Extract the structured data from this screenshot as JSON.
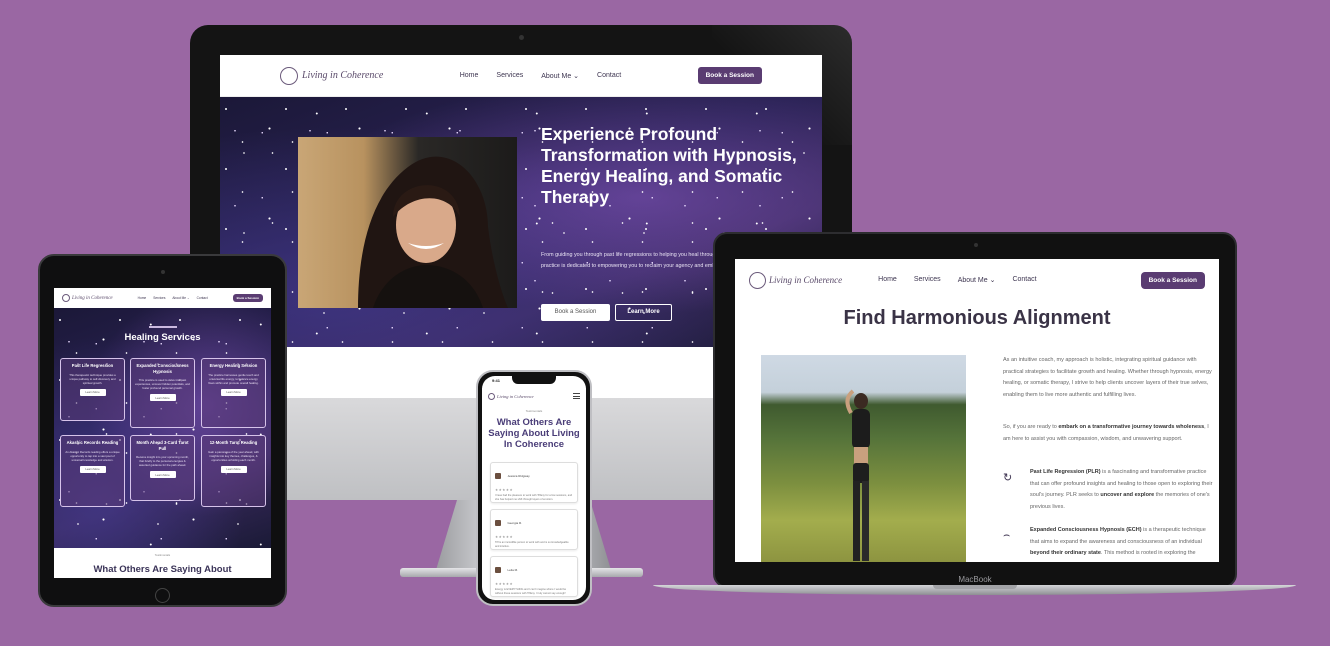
{
  "brand": {
    "logo_text": "Living in Coherence"
  },
  "nav": {
    "home": "Home",
    "services": "Services",
    "about": "About Me ⌄",
    "contact": "Contact",
    "book": "Book a Session"
  },
  "desktop": {
    "hero_title": "Experience Profound Transformation with Hypnosis, Energy Healing, and Somatic Therapy",
    "hero_desc": "From guiding you through past life regressions to helping you heal through the healing power of Reiki, my practice is dedicated to empowering you to reclaim your agency and embrace your full potential.",
    "btn_book": "Book a Session",
    "btn_learn": "Learn More"
  },
  "tablet": {
    "nav_home": "Home",
    "nav_services": "Services",
    "nav_about": "About Me ⌄",
    "nav_contact": "Contact",
    "nav_book": "Book a Session",
    "services_title": "Healing Services",
    "cards": [
      {
        "title": "Past Life Regression",
        "body": "This therapeutic technique provides a unique pathway to self-discovery and spiritual growth.",
        "btn": "Learn More"
      },
      {
        "title": "Expanded Consciousness Hypnosis",
        "body": "This practice is used to delve into past experiences, uncover hidden potentials, and foster profound personal growth.",
        "btn": "Learn More"
      },
      {
        "title": "Energy Healing Session",
        "body": "The practice harnesses gentle touch and universal life energy, to balance energy flows within and promote overall healing.",
        "btn": "Learn More"
      },
      {
        "title": "Akashic Records Reading",
        "body": "An Akashic Records reading offers a unique opportunity to tap into a vast pool of universal knowledge and wisdom.",
        "btn": "Learn More"
      },
      {
        "title": "Month Ahead 3-Card Tarot Pull",
        "body": "Receive insight into your upcoming month, that briefly to the personal energies & assorted guidance for the path ahead.",
        "btn": "Learn More"
      },
      {
        "title": "12-Month Tarot Reading",
        "body": "Gain a panorama of the year ahead, with insights into key themes, challenges, & opportunities unfolding each month.",
        "btn": "Learn More"
      }
    ],
    "eyebrow": "Testimonials",
    "testimonials_title": "What Others Are Saying About"
  },
  "phone": {
    "time": "9:41",
    "eyebrow": "Testimonials",
    "title": "What Others Are Saying About Living In Coherence",
    "reviews": [
      {
        "name": "Jessica Ridgway",
        "stars": "★★★★★",
        "text": "I have had the pleasure to work with Tiffany for a few sessions, and she has helped me shift through layers of emotion."
      },
      {
        "name": "Georgia R.",
        "stars": "★★★★★",
        "text": "Tiff is an incredible person to work with and is so knowledgeable and intuitive."
      },
      {
        "name": "Leila M.",
        "stars": "★★★★★",
        "text": "Energy is EVERYTHING and I can't imagine where I would be without these sessions with Tiffany. I truly cannot say enough!"
      }
    ]
  },
  "laptop": {
    "title": "Find Harmonious Alignment",
    "p1": "As an intuitive coach, my approach is holistic, integrating spiritual guidance with practical strategies to facilitate growth and healing. Whether through hypnosis, energy healing, or somatic therapy, I strive to help clients uncover layers of their true selves, enabling them to live more authentic and fulfilling lives.",
    "p2_a": "So, if you are ready to ",
    "p2_b": "embark on a transformative journey towards wholeness",
    "p2_c": ", I am here to assist you with compassion, wisdom, and unwavering support.",
    "f1_a": "Past Life Regression (PLR)",
    "f1_b": " is a fascinating and transformative practice that can offer profound insights and healing to those open to exploring their soul's journey. PLR seeks to ",
    "f1_c": "uncover and explore",
    "f1_d": " the memories of one's previous lives.",
    "f2_a": "Expanded Consciousness Hypnosis (ECH)",
    "f2_b": " is a therapeutic technique that aims to expand the awareness and consciousness of an individual ",
    "f2_c": "beyond their ordinary state",
    "f2_d": ". This method is rooted in exploring the connection to a more deep ability.",
    "device_label": "MacBook"
  },
  "colors": {
    "background": "#9a67a3",
    "accent": "#5a3c72"
  }
}
